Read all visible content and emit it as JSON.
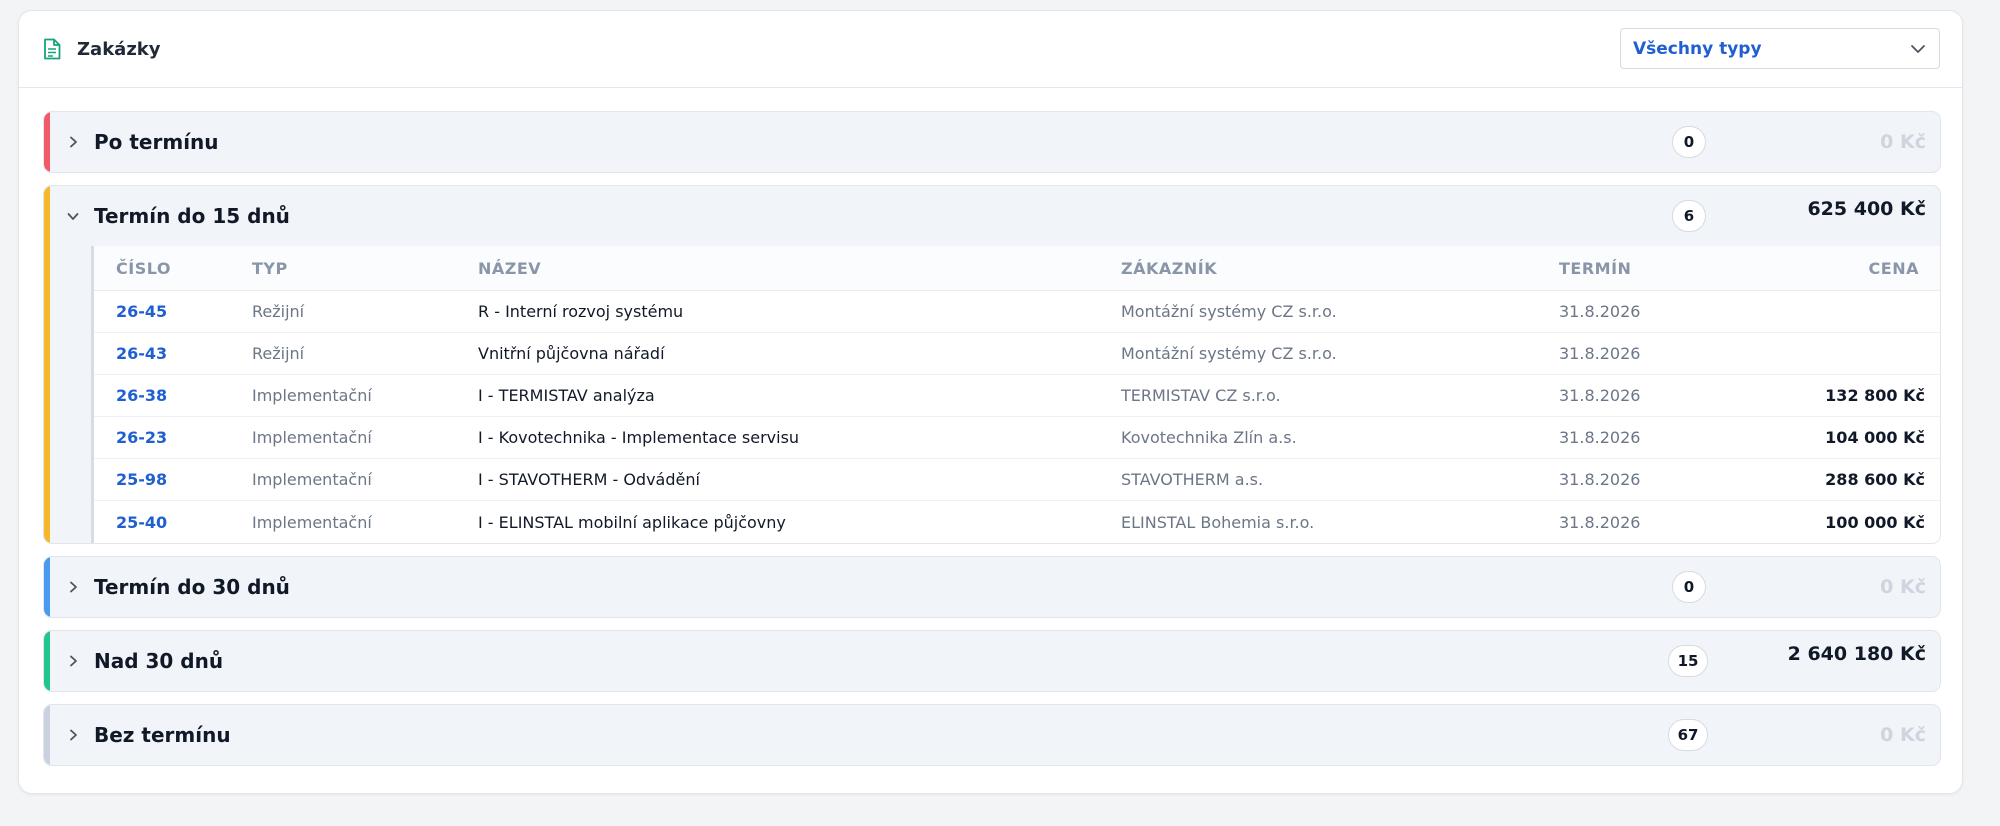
{
  "header": {
    "title": "Zakázky",
    "filter_value": "Všechny typy"
  },
  "colors": {
    "accent": "#1f5fd1",
    "overdue": "#f05a6b",
    "within15": "#f5b72b",
    "within30": "#4a9af0",
    "over30": "#22c58b",
    "noterm": "#c9d2de"
  },
  "icons": {
    "header": "document-icon",
    "filter": "chevron-down-icon",
    "collapsed": "chevron-right-icon",
    "expanded": "chevron-down-icon"
  },
  "groups": [
    {
      "label": "Po termínu",
      "count": "0",
      "sum": "0 Kč"
    },
    {
      "label": "Termín do 15 dnů",
      "count": "6",
      "sum": "625 400 Kč"
    },
    {
      "label": "Termín do 30 dnů",
      "count": "0",
      "sum": "0 Kč"
    },
    {
      "label": "Nad 30 dnů",
      "count": "15",
      "sum": "2 640 180 Kč"
    },
    {
      "label": "Bez termínu",
      "count": "67",
      "sum": "0 Kč"
    }
  ],
  "table": {
    "columns": [
      "ČÍSLO",
      "TYP",
      "NÁZEV",
      "ZÁKAZNÍK",
      "TERMÍN",
      "CENA"
    ],
    "rows": [
      {
        "cislo": "26-45",
        "typ": "Režijní",
        "nazev": "R - Interní rozvoj systému",
        "zakaznik": "Montážní systémy CZ s.r.o.",
        "termin": "31.8.2026",
        "cena": ""
      },
      {
        "cislo": "26-43",
        "typ": "Režijní",
        "nazev": "Vnitřní půjčovna nářadí",
        "zakaznik": "Montážní systémy CZ s.r.o.",
        "termin": "31.8.2026",
        "cena": ""
      },
      {
        "cislo": "26-38",
        "typ": "Implementační",
        "nazev": "I - TERMISTAV analýza",
        "zakaznik": "TERMISTAV CZ s.r.o.",
        "termin": "31.8.2026",
        "cena": "132 800 Kč"
      },
      {
        "cislo": "26-23",
        "typ": "Implementační",
        "nazev": "I - Kovotechnika - Implementace servisu",
        "zakaznik": "Kovotechnika Zlín a.s.",
        "termin": "31.8.2026",
        "cena": "104 000 Kč"
      },
      {
        "cislo": "25-98",
        "typ": "Implementační",
        "nazev": "I - STAVOTHERM - Odvádění",
        "zakaznik": "STAVOTHERM a.s.",
        "termin": "31.8.2026",
        "cena": "288 600 Kč"
      },
      {
        "cislo": "25-40",
        "typ": "Implementační",
        "nazev": "I - ELINSTAL mobilní aplikace půjčovny",
        "zakaznik": "ELINSTAL Bohemia s.r.o.",
        "termin": "31.8.2026",
        "cena": "100 000 Kč"
      }
    ]
  }
}
